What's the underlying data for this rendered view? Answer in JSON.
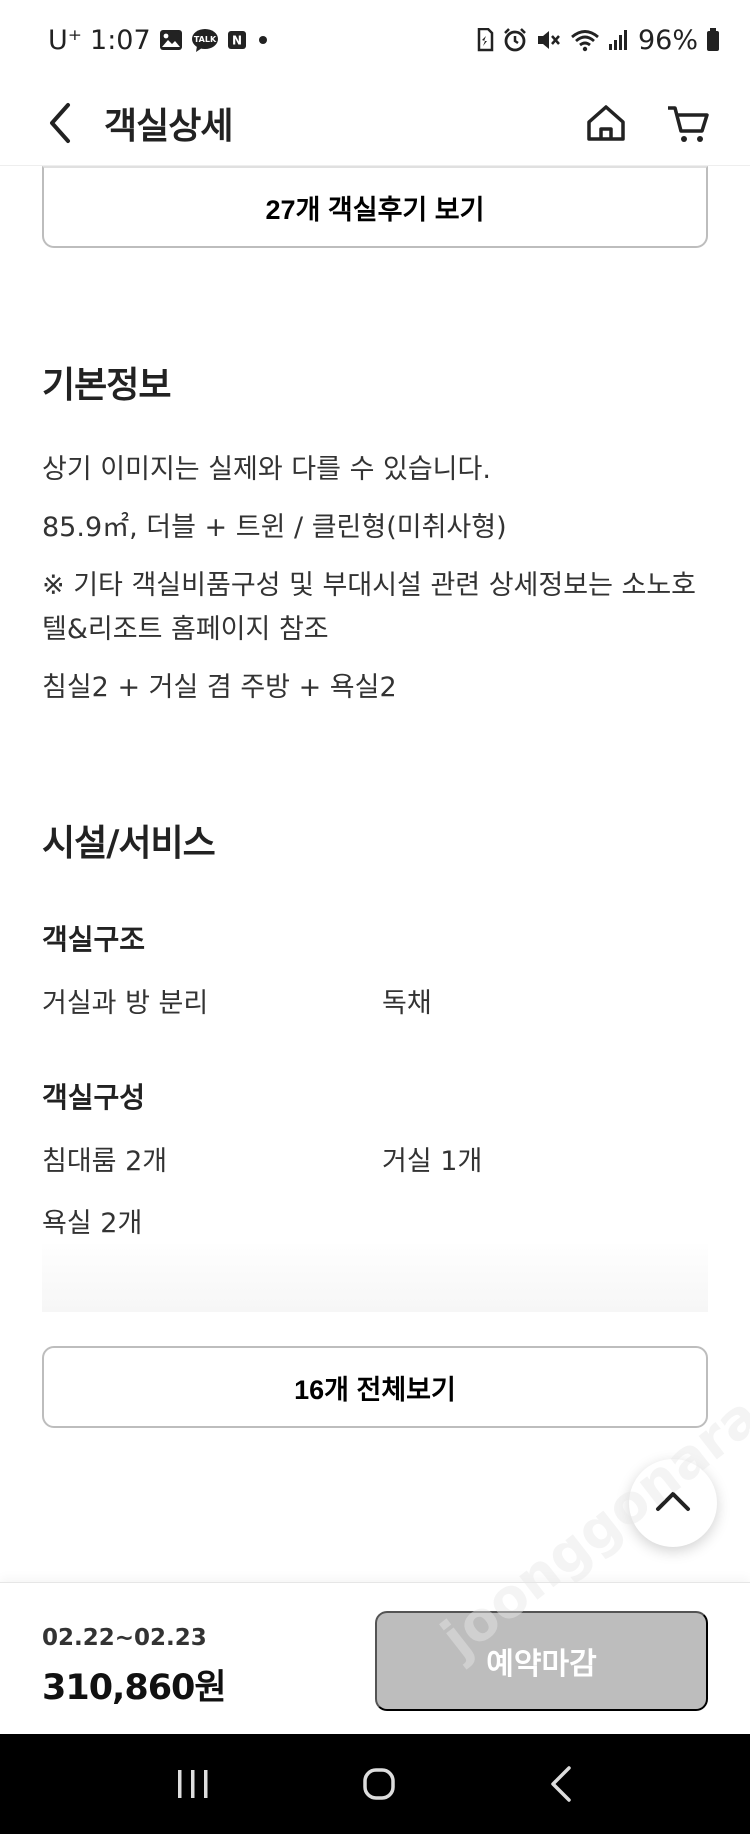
{
  "status_bar": {
    "carrier": "U⁺",
    "time": "1:07",
    "battery": "96%",
    "icons": [
      "gallery-icon",
      "kakaotalk-icon",
      "naver-icon",
      "dot-icon",
      "sim-icon",
      "alarm-icon",
      "mute-icon",
      "wifi-icon",
      "signal-icon",
      "battery-icon"
    ],
    "notification_labels": {
      "talk": "TALK",
      "naver": "N"
    }
  },
  "header": {
    "title": "객실상세",
    "back_icon": "chevron-left-icon",
    "home_icon": "home-icon",
    "cart_icon": "cart-icon"
  },
  "review_button": {
    "label": "27개 객실후기 보기"
  },
  "basic_info": {
    "title": "기본정보",
    "lines": [
      "상기 이미지는 실제와 다를 수 있습니다.",
      "85.9㎡, 더블 + 트윈 / 클린형(미취사형)",
      "※ 기타 객실비품구성 및 부대시설 관련 상세정보는 소노호텔&리조트 홈페이지 참조",
      "침실2 + 거실 겸 주방 + 욕실2"
    ]
  },
  "facilities": {
    "title": "시설/서비스",
    "room_structure": {
      "title": "객실구조",
      "items": [
        "거실과 방 분리",
        "독채"
      ]
    },
    "room_composition": {
      "title": "객실구성",
      "items": [
        "침대룸 2개",
        "거실 1개",
        "욕실 2개"
      ]
    },
    "all_button": "16개 전체보기"
  },
  "bottom": {
    "date_range": "02.22~02.23",
    "price": "310,860원",
    "reserve_button": "예약마감"
  },
  "watermark": "joonggonara",
  "colors": {
    "disabled_button": "#bdbdbd",
    "nav_bar": "#000000",
    "border": "#bdbdbd",
    "text": "#222222"
  }
}
